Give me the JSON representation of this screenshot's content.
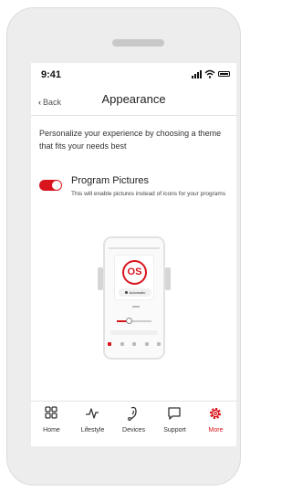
{
  "status_bar": {
    "time": "9:41"
  },
  "nav": {
    "back_label": "Back",
    "title": "Appearance"
  },
  "intro_text": "Personalize your experience by choosing a theme that fits your needs best",
  "setting": {
    "label": "Program Pictures",
    "description": "This will enable pictures instead of icons for your programs",
    "enabled": true
  },
  "preview": {
    "logo_text": "OS",
    "program_label": "Automatic",
    "volume_level": 0.35
  },
  "tabs": [
    {
      "label": "Home",
      "icon": "home-grid-icon",
      "active": false
    },
    {
      "label": "Lifestyle",
      "icon": "pulse-icon",
      "active": false
    },
    {
      "label": "Devices",
      "icon": "hearing-aid-icon",
      "active": false
    },
    {
      "label": "Support",
      "icon": "chat-bubble-icon",
      "active": false
    },
    {
      "label": "More",
      "icon": "gear-icon",
      "active": true
    }
  ],
  "colors": {
    "accent": "#d8141c",
    "text": "#222222",
    "divider": "#e2e2e2"
  }
}
